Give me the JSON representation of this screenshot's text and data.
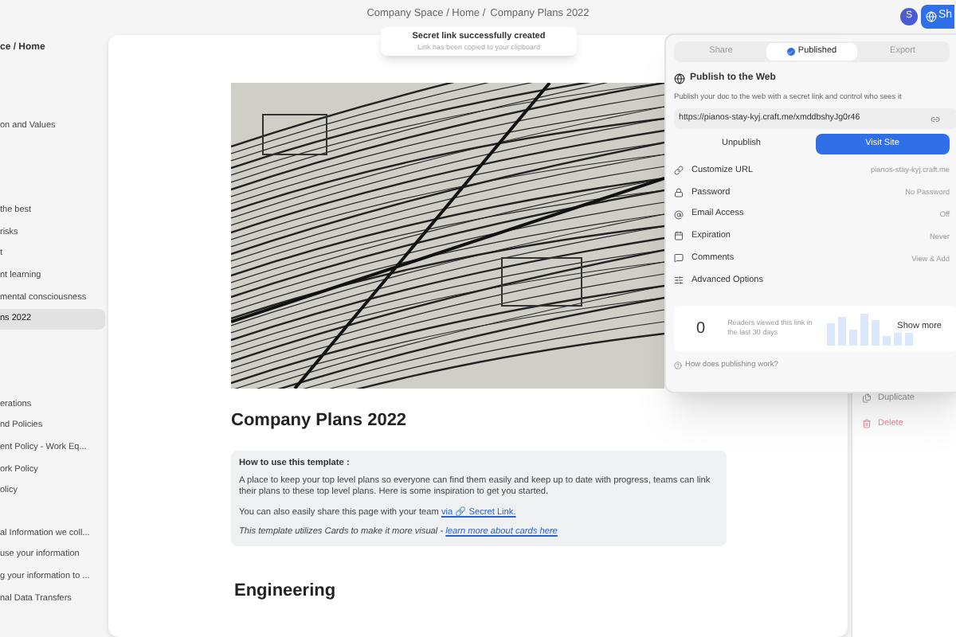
{
  "breadcrumb": {
    "path": "Company Space / Home /",
    "current": "Company Plans 2022"
  },
  "toast": {
    "title": "Secret link successfully created",
    "message": "Link has been copied to your clipboard"
  },
  "header": {
    "avatar": "S",
    "share_button": "Sh"
  },
  "sidebar": {
    "title": "ce / Home",
    "groups": [
      {
        "items": [
          {
            "label": "on and Values",
            "selected": false
          }
        ]
      },
      {
        "items": [
          {
            "label": "the best",
            "selected": false
          },
          {
            "label": "risks",
            "selected": false
          },
          {
            "label": "t",
            "selected": false
          },
          {
            "label": "nt learning",
            "selected": false
          },
          {
            "label": "mental consciousness",
            "selected": false
          },
          {
            "label": "ns 2022",
            "selected": true
          }
        ]
      },
      {
        "items": [
          {
            "label": "erations",
            "selected": false
          },
          {
            "label": "nd Policies",
            "selected": false
          },
          {
            "label": "ent Policy - Work Eq...",
            "selected": false
          },
          {
            "label": "ork Policy",
            "selected": false
          },
          {
            "label": "olicy",
            "selected": false
          }
        ]
      },
      {
        "items": [
          {
            "label": "al Information we coll...",
            "selected": false
          },
          {
            "label": "use your information",
            "selected": false
          },
          {
            "label": "g your information to ...",
            "selected": false
          },
          {
            "label": "nal Data Transfers",
            "selected": false
          }
        ]
      }
    ]
  },
  "document": {
    "title": "Company Plans 2022",
    "callout": {
      "heading": "How to use this template :",
      "paragraph": "A place to keep your top level plans so everyone can find them easily and keep up to date with progress, teams can link their plans to these top level plans. Here is some inspiration to get you started.",
      "share_text": "You can also easily share this page with your team ",
      "share_link": "via 🔗 Secret Link.",
      "note": "This template utilizes Cards to make it more visual - ",
      "note_link": "learn more about cards here"
    },
    "section": "Engineering"
  },
  "side_menu": [
    {
      "label": "Duplicate",
      "kind": "normal"
    },
    {
      "label": "Delete",
      "kind": "danger"
    }
  ],
  "publish_popover": {
    "tabs": [
      {
        "label": "Share",
        "selected": false
      },
      {
        "label": "Published",
        "selected": true
      },
      {
        "label": "Export",
        "selected": false
      }
    ],
    "title": "Publish to the Web",
    "description": "Publish your doc to the web with a secret link and control who sees it",
    "url": "https://pianos-stay-kyj.craft.me/xmddbshyJg0r46",
    "unpublish": "Unpublish",
    "visit": "Visit Site",
    "settings": [
      {
        "label": "Customize URL",
        "value": "pianos-stay-kyj.craft.me"
      },
      {
        "label": "Password",
        "value": "No Password"
      },
      {
        "label": "Email Access",
        "value": "Off"
      },
      {
        "label": "Expiration",
        "value": "Never"
      },
      {
        "label": "Comments",
        "value": "View & Add"
      },
      {
        "label": "Advanced Options"
      }
    ],
    "stats": {
      "count": "0",
      "caption": "Readers viewed this link in the last 30 days",
      "button": "Show more"
    },
    "help": "How does publishing work?"
  }
}
